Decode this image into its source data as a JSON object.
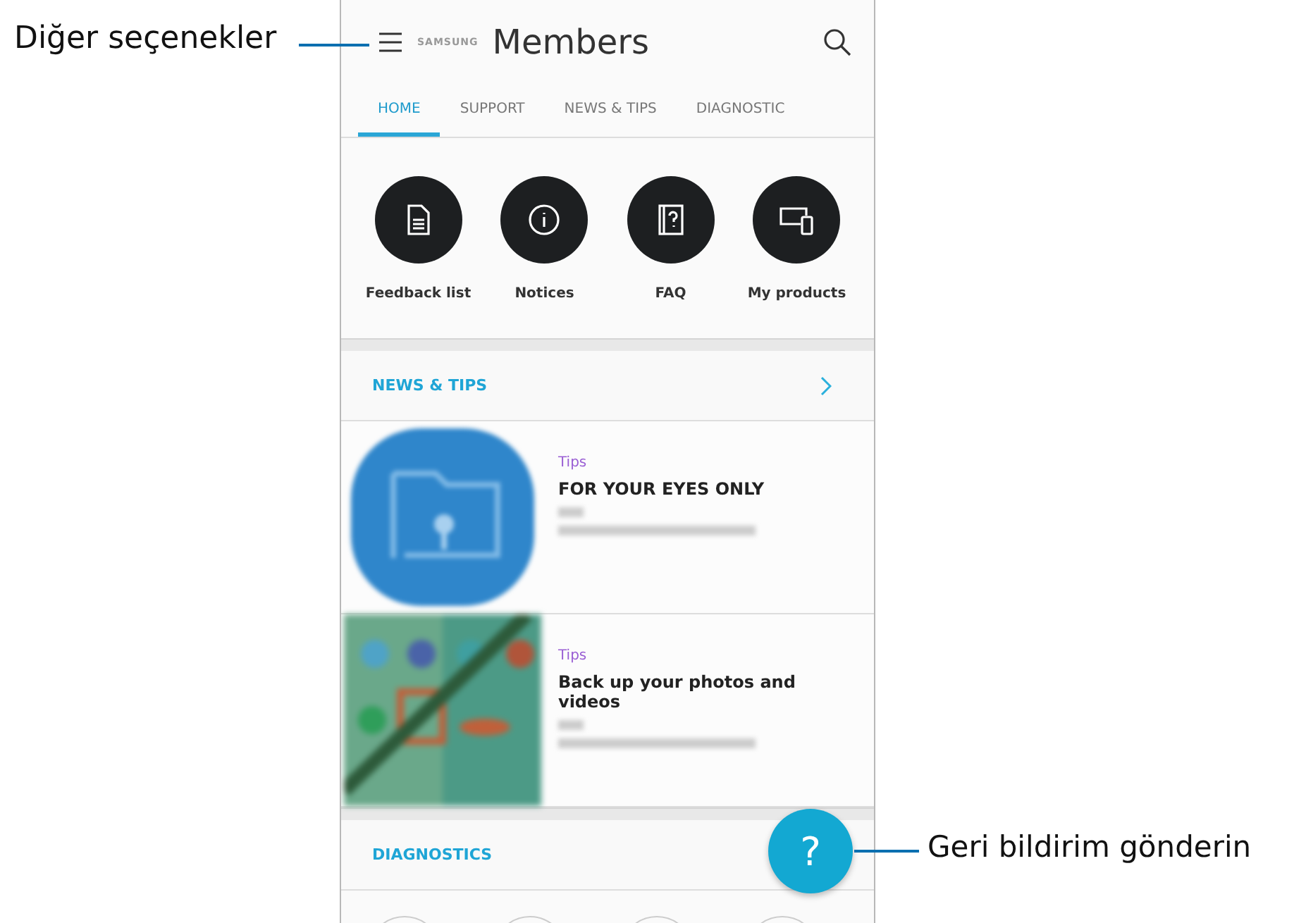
{
  "callouts": [
    {
      "kind": "menu",
      "text": "Diğer seçenekler"
    },
    {
      "kind": "fab",
      "text": "Geri bildirim gönderin"
    }
  ],
  "header": {
    "brand": "SAMSUNG",
    "title": "Members"
  },
  "tabs": [
    {
      "label": "HOME",
      "selected": true
    },
    {
      "label": "SUPPORT",
      "selected": false
    },
    {
      "label": "NEWS & TIPS",
      "selected": false
    },
    {
      "label": "DIAGNOSTIC",
      "selected": false
    }
  ],
  "shortcuts": [
    {
      "kind": "document",
      "label": "Feedback list"
    },
    {
      "kind": "info",
      "label": "Notices"
    },
    {
      "kind": "faq",
      "label": "FAQ"
    },
    {
      "kind": "devices",
      "label": "My products"
    }
  ],
  "news_section": {
    "title": "NEWS & TIPS"
  },
  "articles": [
    {
      "kind": "folder",
      "tag": "Tips",
      "title": "FOR YOUR EYES ONLY"
    },
    {
      "kind": "picture",
      "tag": "Tips",
      "title": "Back up your photos and videos"
    }
  ],
  "diagnostics_section": {
    "title": "DIAGNOSTICS"
  },
  "fab": {
    "label": "?"
  }
}
